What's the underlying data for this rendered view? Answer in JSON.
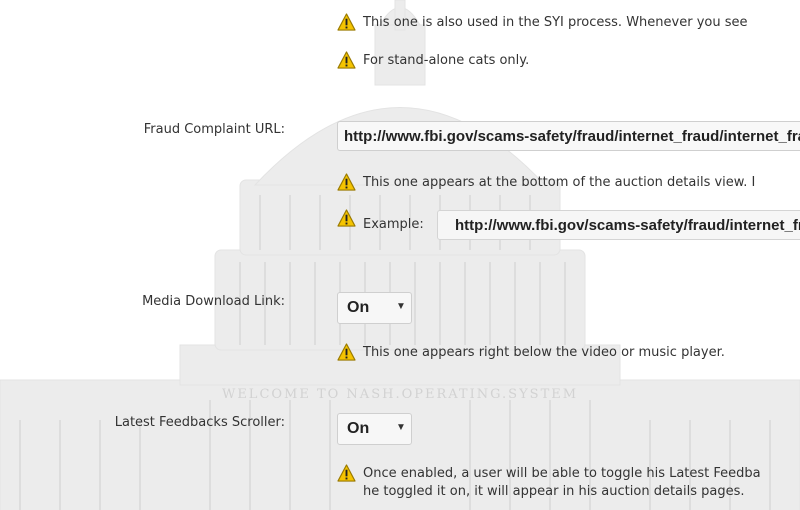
{
  "rows": {
    "syi_hint": "This one is also used in the SYI process. Whenever you see",
    "standalone_hint": "For stand-alone cats only.",
    "fraud": {
      "label": "Fraud Complaint URL:",
      "value": "http://www.fbi.gov/scams-safety/fraud/internet_fraud/internet_fraud",
      "hint": "This one appears at the bottom of the auction details view. I",
      "example_label": "Example:",
      "example_value": "http://www.fbi.gov/scams-safety/fraud/internet_fraud/"
    },
    "media": {
      "label": "Media Download Link:",
      "value": "On",
      "hint": "This one appears right below the video or music player."
    },
    "feedbacks": {
      "label": "Latest Feedbacks Scroller:",
      "value": "On",
      "hint_line1": "Once enabled, a user will be able to toggle his Latest Feedba",
      "hint_line2": "he toggled it on, it will appear in his auction details pages."
    }
  },
  "background_watermark": "WELCOME TO NASH.OPERATING.SYSTEM",
  "colors": {
    "warning": "#f5c400",
    "warning_border": "#9a7a00"
  }
}
